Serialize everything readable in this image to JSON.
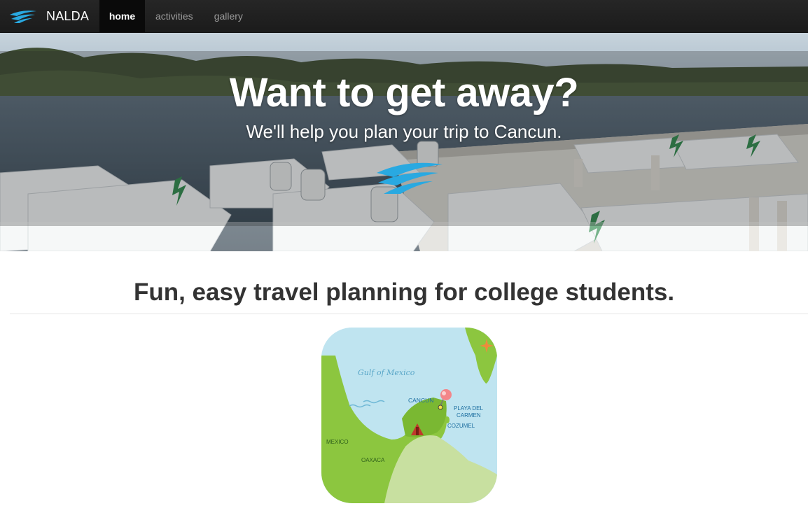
{
  "nav": {
    "brand": "NALDA",
    "brand_icon": "wave-logo-icon",
    "items": [
      {
        "label": "home",
        "active": true
      },
      {
        "label": "activities",
        "active": false
      },
      {
        "label": "gallery",
        "active": false
      }
    ]
  },
  "hero": {
    "title": "Want to get away?",
    "subtitle": "We'll help you plan your trip to Cancun.",
    "logo_icon": "wave-logo-icon"
  },
  "main": {
    "tagline": "Fun, easy travel planning for college students."
  },
  "map": {
    "labels": {
      "gulf": "Gulf of Mexico",
      "cancun": "CANCUN",
      "playa1": "PLAYA DEL",
      "playa2": "CARMEN",
      "cozumel": "COZUMEL",
      "mexico": "MEXICO",
      "oaxaca": "OAXACA"
    },
    "icons": [
      "push-pin-icon",
      "pyramid-icon",
      "compass-star-icon"
    ]
  },
  "colors": {
    "brand_blue": "#29a9e1",
    "navbar": "#222222",
    "land_green": "#8cc63f",
    "sea": "#bfe4f0"
  }
}
